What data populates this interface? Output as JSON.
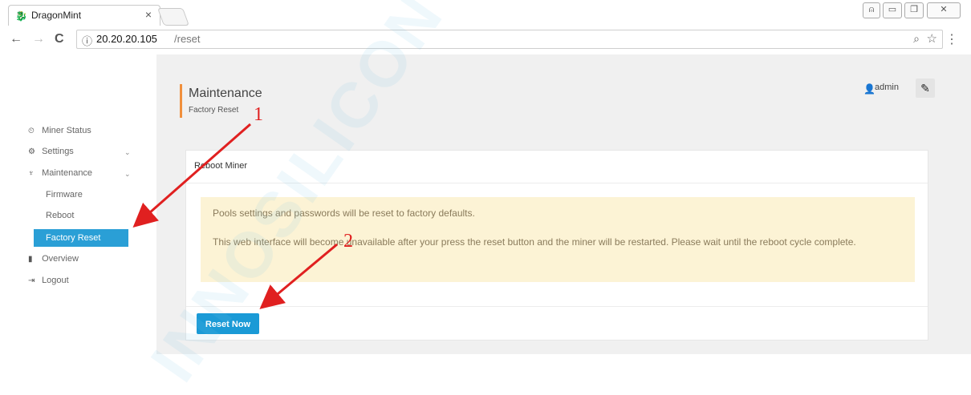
{
  "browser": {
    "tab_title": "DragonMint",
    "tab_close": "×",
    "url_info_icon": "ⓘ",
    "url_host": "20.20.20.105",
    "url_path": "/reset",
    "back_icon": "←",
    "forward_icon": "→",
    "reload_icon": "C",
    "zoom_icon": "🔍",
    "star_icon": "☆",
    "menu_icon": "⋮"
  },
  "sidebar": {
    "items": [
      {
        "label": "Miner Status",
        "icon": "dashboard-icon"
      },
      {
        "label": "Settings",
        "icon": "cogs-icon"
      },
      {
        "label": "Maintenance",
        "icon": "plug-icon"
      },
      {
        "label": "Overview",
        "icon": "book-icon"
      },
      {
        "label": "Logout",
        "icon": "sign-out-icon"
      }
    ],
    "sub_items": [
      {
        "label": "Firmware"
      },
      {
        "label": "Reboot"
      },
      {
        "label": "Factory Reset"
      }
    ]
  },
  "header": {
    "title": "Maintenance",
    "subtitle": "Factory Reset",
    "user": "admin"
  },
  "card": {
    "title": "Reboot Miner",
    "warning_line1": "Pools settings and passwords will be reset to factory defaults.",
    "warning_line2": "This web interface will become unavailable after your press the reset button and the miner will be restarted. Please wait until the reboot cycle complete.",
    "button": "Reset Now"
  },
  "annotations": {
    "marker1": "1",
    "marker2": "2",
    "watermark": "INNOSILICON"
  },
  "colors": {
    "accent": "#2a9fd6",
    "header_bar": "#f08f3c",
    "warning_bg": "#fcf3d5",
    "annotation": "#e02020"
  }
}
